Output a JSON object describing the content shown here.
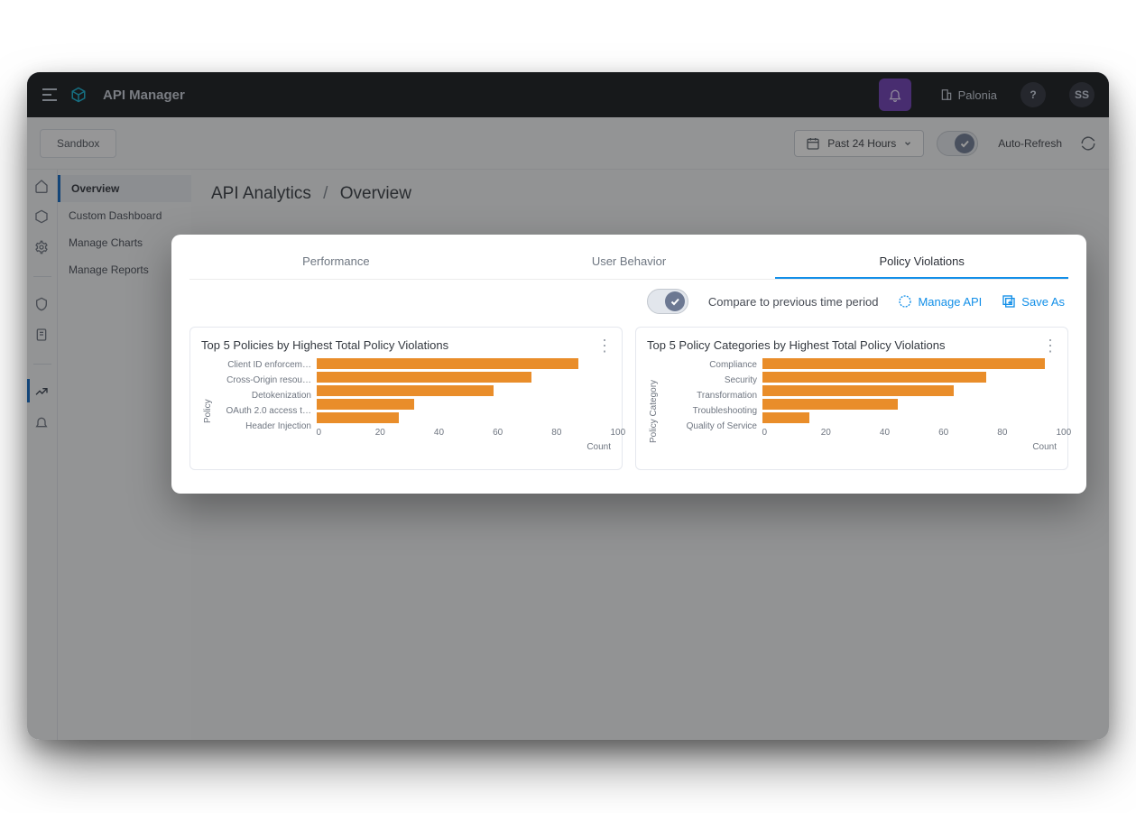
{
  "header": {
    "app_title": "API Manager",
    "org_name": "Palonia",
    "avatar_initials": "SS",
    "help_label": "?"
  },
  "toolbar": {
    "env_label": "Sandbox",
    "time_range": "Past 24 Hours",
    "auto_refresh_label": "Auto-Refresh"
  },
  "nav": {
    "items": [
      "Overview",
      "Custom Dashboard",
      "Manage Charts",
      "Manage Reports"
    ],
    "active": "Overview"
  },
  "breadcrumb": {
    "root": "API Analytics",
    "sep": "/",
    "leaf": "Overview"
  },
  "panel": {
    "tabs": [
      "Performance",
      "User Behavior",
      "Policy Violations"
    ],
    "active_tab": "Policy Violations",
    "compare_label": "Compare to previous time period",
    "manage_api_label": "Manage API",
    "save_as_label": "Save As"
  },
  "chart_data": [
    {
      "type": "bar",
      "title": "Top 5 Policies by Highest Total Policy Violations",
      "ylabel": "Policy",
      "xlabel": "Count",
      "xlim": [
        0,
        100
      ],
      "ticks": [
        0,
        20,
        40,
        60,
        80,
        100
      ],
      "categories": [
        "Client ID enforcem…",
        "Cross-Origin resou…",
        "Detokenization",
        "OAuth 2.0 access t…",
        "Header Injection"
      ],
      "values": [
        89,
        73,
        60,
        33,
        28
      ]
    },
    {
      "type": "bar",
      "title": "Top 5 Policy Categories by Highest Total Policy Violations",
      "ylabel": "Policy Category",
      "xlabel": "Count",
      "xlim": [
        0,
        100
      ],
      "ticks": [
        0,
        20,
        40,
        60,
        80,
        100
      ],
      "categories": [
        "Compliance",
        "Security",
        "Transformation",
        "Troubleshooting",
        "Quality of Service"
      ],
      "values": [
        96,
        76,
        65,
        46,
        16
      ]
    }
  ]
}
